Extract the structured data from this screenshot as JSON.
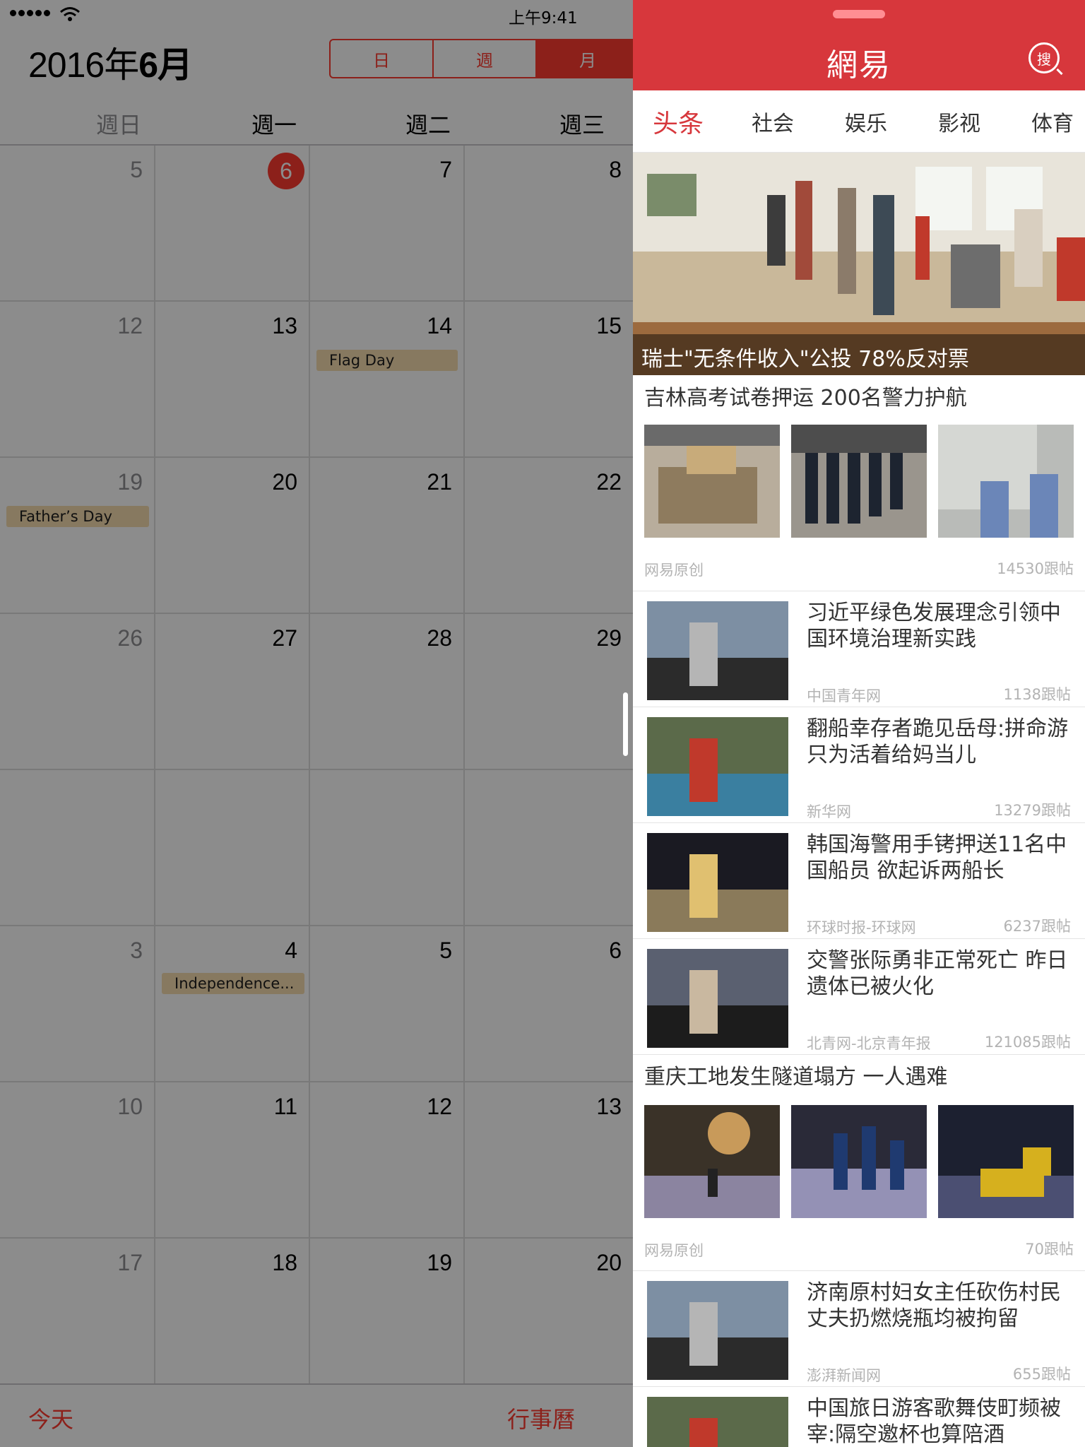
{
  "status_bar": {
    "time": "上午9:41"
  },
  "calendar": {
    "title_year": "2016年",
    "title_month": "6月",
    "segments": [
      "日",
      "週",
      "月"
    ],
    "weekday_headers": [
      "週日",
      "週一",
      "週二",
      "週三"
    ],
    "rows": [
      [
        "5",
        "6",
        "7",
        "8"
      ],
      [
        "12",
        "13",
        "14",
        "15"
      ],
      [
        "19",
        "20",
        "21",
        "22"
      ],
      [
        "26",
        "27",
        "28",
        "29"
      ],
      [
        "",
        "",
        "",
        ""
      ],
      [
        "3",
        "4",
        "5",
        "6"
      ],
      [
        "10",
        "11",
        "12",
        "13"
      ],
      [
        "17",
        "18",
        "19",
        "20"
      ]
    ],
    "events": {
      "flag_day": "Flag Day",
      "fathers_day": "Father’s Day",
      "independence": "Independence..."
    },
    "toolbar": {
      "today": "今天",
      "calendars": "行事曆"
    }
  },
  "news": {
    "logo": "網易",
    "search_label": "搜",
    "tabs": [
      "头条",
      "社会",
      "娱乐",
      "影视",
      "体育"
    ],
    "hero_caption": "瑞士\"无条件收入\"公投 78%反对票",
    "gallery1": {
      "title": "吉林高考试卷押运 200名警力护航",
      "source": "网易原创",
      "comments": "14530跟帖"
    },
    "items": [
      {
        "title": "习近平绿色发展理念引领中国环境治理新实践",
        "source": "中国青年网",
        "comments": "1138跟帖"
      },
      {
        "title": "翻船幸存者跪见岳母:拼命游只为活着给妈当儿",
        "source": "新华网",
        "comments": "13279跟帖"
      },
      {
        "title": "韩国海警用手铐押送11名中国船员 欲起诉两船长",
        "source": "环球时报-环球网",
        "comments": "6237跟帖"
      },
      {
        "title": "交警张际勇非正常死亡 昨日遗体已被火化",
        "source": "北青网-北京青年报",
        "comments": "121085跟帖"
      }
    ],
    "gallery2": {
      "title": "重庆工地发生隧道塌方 一人遇难",
      "source": "网易原创",
      "comments": "70跟帖"
    },
    "items2": [
      {
        "title": "济南原村妇女主任砍伤村民 丈夫扔燃烧瓶均被拘留",
        "source": "澎湃新闻网",
        "comments": "655跟帖"
      },
      {
        "title": "中国旅日游客歌舞伎町频被宰:隔空邀杯也算陪酒",
        "source": "",
        "comments": ""
      }
    ]
  },
  "colors": {
    "accent_red": "#ff3b30",
    "netease_red": "#d7373c",
    "event_tan": "#f6dcb0"
  }
}
